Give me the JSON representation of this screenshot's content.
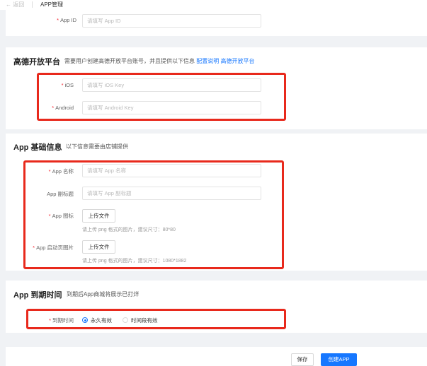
{
  "header": {
    "back_label": "← 返回",
    "title": "APP管理"
  },
  "top_section": {
    "field_label": "App ID",
    "placeholder": "请填写 App ID"
  },
  "gaode": {
    "title": "高德开放平台",
    "desc": "需要用户创建高德开放平台账号，并且提供以下信息",
    "link_config": "配置说明",
    "link_platform": "高德开放平台",
    "ios_label": "iOS",
    "ios_placeholder": "请填写 iOS Key",
    "android_label": "Android",
    "android_placeholder": "请填写 Android Key"
  },
  "basic": {
    "title": "App 基础信息",
    "desc": "以下信息需要由店铺提供",
    "name_label": "App 名称",
    "name_placeholder": "请填写 App 名称",
    "subtitle_label": "App 副标题",
    "subtitle_placeholder": "请填写 App 副标题",
    "icon_label": "App 图标",
    "icon_button": "上传文件",
    "icon_hint": "请上传 png 格式的图片，建议尺寸：80*80",
    "splash_label": "App 启动页图片",
    "splash_button": "上传文件",
    "splash_hint": "请上传 png 格式的图片，建议尺寸：1080*1882"
  },
  "expire": {
    "title": "App 到期时间",
    "desc": "到期后App商城将展示已打烊",
    "field_label": "到期时间",
    "option_forever": "永久有效",
    "option_period": "时间段有效",
    "selected": "永久有效"
  },
  "footer": {
    "save_label": "保存",
    "create_label": "创建APP"
  },
  "colors": {
    "highlight_box": "#e8291c",
    "primary": "#1677ff"
  }
}
